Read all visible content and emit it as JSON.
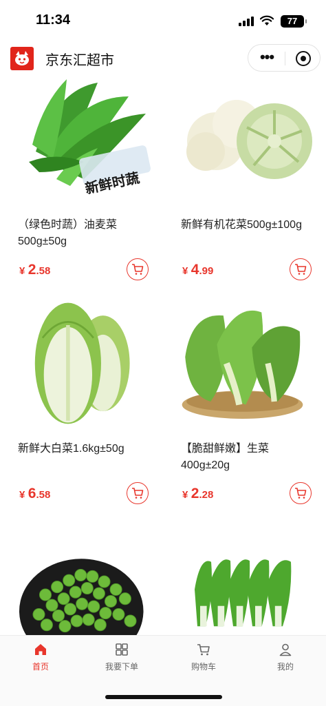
{
  "status_bar": {
    "time": "11:34",
    "battery": "77"
  },
  "nav": {
    "title": "京东汇超市",
    "more_icon": "more-dots-icon",
    "close_icon": "target-icon"
  },
  "products": [
    {
      "name": "（绿色时蔬）油麦菜500g±50g",
      "price_currency": "¥",
      "price_int": "2",
      "price_dec": ".58",
      "image_icon": "lettuce-stems",
      "image_label": "新鲜时蔬"
    },
    {
      "name": "新鲜有机花菜500g±100g",
      "price_currency": "¥",
      "price_int": "4",
      "price_dec": ".99",
      "image_icon": "cauliflower"
    },
    {
      "name": "新鲜大白菜1.6kg±50g",
      "price_currency": "¥",
      "price_int": "6",
      "price_dec": ".58",
      "image_icon": "napa-cabbage"
    },
    {
      "name": "【脆甜鲜嫩】生菜400g±20g",
      "price_currency": "¥",
      "price_int": "2",
      "price_dec": ".28",
      "image_icon": "romaine-lettuce"
    },
    {
      "name": "",
      "image_icon": "green-peas"
    },
    {
      "name": "",
      "image_icon": "lettuce-bunch"
    }
  ],
  "tabs": [
    {
      "label": "首页",
      "icon": "home-icon",
      "active": true
    },
    {
      "label": "我要下单",
      "icon": "grid-icon",
      "active": false
    },
    {
      "label": "购物车",
      "icon": "cart-icon",
      "active": false
    },
    {
      "label": "我的",
      "icon": "person-icon",
      "active": false
    }
  ],
  "colors": {
    "accent": "#e8362c",
    "brand": "#e1251b"
  }
}
